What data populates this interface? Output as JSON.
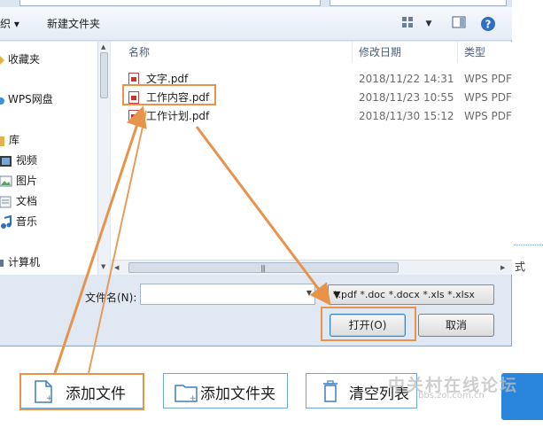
{
  "toolbar": {
    "organize_label": "织 ▾",
    "new_folder_label": "新建文件夹",
    "view_icon": "view-icon",
    "preview_icon": "preview-pane-icon",
    "help_icon": "help-icon"
  },
  "nav": {
    "items": [
      {
        "label": "收藏夹",
        "icon": "favorites-star-icon"
      },
      {
        "label": "WPS网盘",
        "icon": "cloud-drive-icon"
      },
      {
        "label": "库",
        "icon": "library-icon"
      },
      {
        "label": "视频",
        "icon": "video-library-icon"
      },
      {
        "label": "图片",
        "icon": "pictures-library-icon"
      },
      {
        "label": "文档",
        "icon": "documents-library-icon"
      },
      {
        "label": "音乐",
        "icon": "music-library-icon"
      },
      {
        "label": "计算机",
        "icon": "computer-icon"
      }
    ]
  },
  "file_list": {
    "columns": {
      "name": "名称",
      "modified": "修改日期",
      "type": "类型"
    },
    "rows": [
      {
        "name": "文字.pdf",
        "modified": "2018/11/22 14:31",
        "type": "WPS PDF"
      },
      {
        "name": "工作内容.pdf",
        "modified": "2018/11/23 10:55",
        "type": "WPS PDF"
      },
      {
        "name": "工作计划.pdf",
        "modified": "2018/11/30 15:12",
        "type": "WPS PDF"
      }
    ]
  },
  "dialog_bottom": {
    "filename_label": "文件名(N):",
    "filename_value": "",
    "filetype_value": "*.pdf *.doc *.docx *.xls *.xlsx",
    "open_button": "打开(O)",
    "cancel_button": "取消"
  },
  "background": {
    "side_text": "式"
  },
  "app_toolbar": {
    "add_file": "添加文件",
    "add_folder": "添加文件夹",
    "clear_list": "清空列表"
  },
  "watermark": {
    "text": "中关村在线论坛",
    "url": "bbs.zol.com.cn"
  },
  "colors": {
    "annotation": "#e8934a",
    "app_border": "#6fa7d8",
    "start_button": "#2a86dd"
  }
}
